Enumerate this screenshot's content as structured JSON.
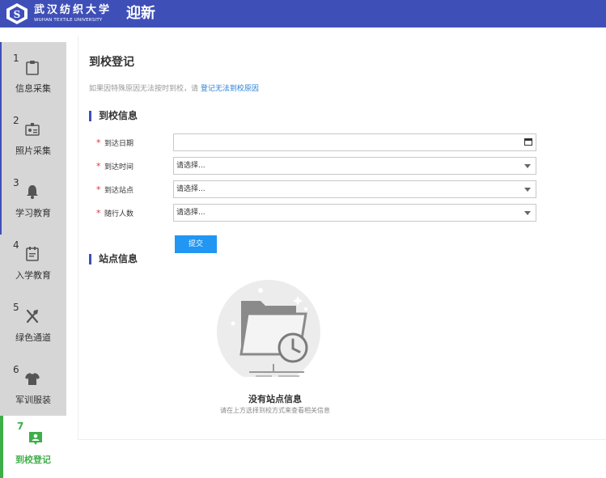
{
  "header": {
    "brand_cn": "武汉纺织大学",
    "brand_en": "WUHAN TEXTILE UNIVERSITY",
    "title": "迎新",
    "color": "#3f4fb8"
  },
  "sidebar": {
    "items": [
      {
        "num": "1",
        "label": "信息采集",
        "icon": "clipboard-icon"
      },
      {
        "num": "2",
        "label": "照片采集",
        "icon": "id-card-icon"
      },
      {
        "num": "3",
        "label": "学习教育",
        "icon": "bell-icon"
      },
      {
        "num": "4",
        "label": "入学教育",
        "icon": "document-icon"
      },
      {
        "num": "5",
        "label": "绿色通道",
        "icon": "utensils-icon"
      },
      {
        "num": "6",
        "label": "军训服装",
        "icon": "tshirt-icon"
      },
      {
        "num": "7",
        "label": "到校登记",
        "icon": "person-badge-icon",
        "active": true
      }
    ],
    "active_color": "#3fae49"
  },
  "main": {
    "title": "到校登记",
    "notice_text": "如果因特殊原因无法按时到校，请",
    "notice_link": "登记无法到校原因",
    "arrival_section": "到校信息",
    "fields": {
      "date": {
        "label": "到达日期",
        "value": ""
      },
      "time": {
        "label": "到达时间",
        "value": "请选择..."
      },
      "station": {
        "label": "到达站点",
        "value": "请选择..."
      },
      "companions": {
        "label": "随行人数",
        "value": "请选择..."
      }
    },
    "required_mark": "*",
    "submit_label": "提交",
    "station_section": "站点信息",
    "empty_title": "没有站点信息",
    "empty_subtitle": "请在上方选择到校方式来查看相关信息"
  }
}
